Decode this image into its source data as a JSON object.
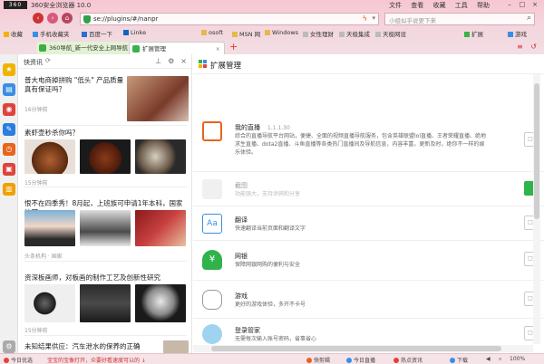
{
  "window": {
    "logo_text": "360",
    "title": "360安全浏览器 10.0",
    "menu": [
      "文件",
      "查看",
      "收藏",
      "工具",
      "帮助"
    ],
    "controls": [
      "–",
      "□",
      "×"
    ]
  },
  "address_bar": {
    "url": "se://plugins/#/nanpr",
    "search_placeholder": "小组似乎说更下来"
  },
  "favorites": [
    "收藏",
    "手机收藏夹",
    "百度一下",
    "Linke",
    "osoft",
    "MSN 网",
    "Windows",
    "女性理财",
    "天极集成",
    "天极网设",
    "扩展",
    "游戏"
  ],
  "tabs": [
    {
      "label": "360导航_新一代安全上网导航"
    },
    {
      "label": "扩展管理"
    }
  ],
  "tab_new": "+",
  "news": {
    "header": "快资讯",
    "items": [
      {
        "title": "普大电商掉拼购 \"低头\" 产品质量真有保证吗？",
        "meta": "16分钟前"
      },
      {
        "title": "素虾壶秒杀你吗？",
        "meta": "15分钟前"
      },
      {
        "title": "恨不在四季秀！8月起，上班族可申请1年本科，国家认可",
        "meta": "头条机构 · 国家"
      },
      {
        "title": "资深板画师，对板画的制作工艺及创新性研究",
        "meta": "15分钟前"
      },
      {
        "title": "未知结果供应：汽车泄水的保养的正确",
        "meta": ""
      }
    ]
  },
  "extensions": {
    "title": "扩展管理",
    "items": [
      {
        "name": "我的直播",
        "version": "1.1.1.30",
        "desc": "综合的直播导航平台网站，便捷、全面的视频直播导航服务，包含英雄联盟lol直播、王者荣耀直播、绝地求生直播、dota2直播、斗鱼直播等各类热门直播间及导航信息，内容丰富，更新及时，绝你不一样的娱乐体验。",
        "enabled": false
      },
      {
        "name": "截图",
        "version": "",
        "desc": "功能强大，支持涂鸦和分享",
        "enabled": true
      },
      {
        "name": "翻译",
        "version": "",
        "desc": "快速翻译当前页面和翻译文字",
        "enabled": false
      },
      {
        "name": "网银",
        "version": "",
        "desc": "保障网银网购的便利与安全",
        "enabled": false
      },
      {
        "name": "游戏",
        "version": "",
        "desc": "更好的游戏体验，多开不卡号",
        "enabled": false
      },
      {
        "name": "登录管家",
        "version": "",
        "desc": "无需每次输入账号密码，省事省心",
        "enabled": false
      }
    ]
  },
  "status_bar": {
    "left": "今日优选",
    "ticker": "宝宝的宝像打开，众要好看速度可以的 ↓",
    "items": [
      "快剪辑",
      "今日直播",
      "热点资讯",
      "下载",
      "100%"
    ]
  },
  "colors": {
    "chrome_pink": "#f4d4dc",
    "enabled_green": "#2fb34a",
    "live_orange": "#e8641c"
  }
}
